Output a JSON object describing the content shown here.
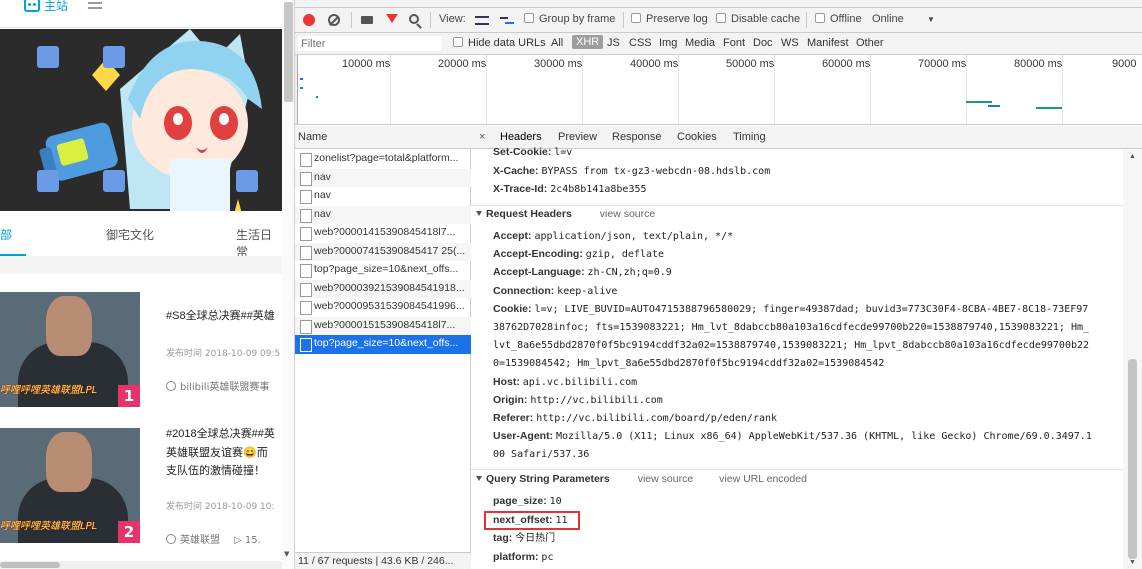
{
  "left_page": {
    "home_label": "主站",
    "tabs": [
      "部",
      "御宅文化",
      "生活日常"
    ],
    "cards": [
      {
        "title": "#S8全球总决赛##英雄",
        "date": "发布时间 2018-10-09 09:5",
        "uploader": "bilibili英雄联盟赛事",
        "thumb_caption": "呼哩呼哩英雄联盟LPL",
        "rank": "1"
      },
      {
        "title": "#2018全球总决赛##英",
        "title_line2": "英雄联盟友谊赛😄而",
        "title_line3": "支队伍的激情碰撞！",
        "date": "发布时间 2018-10-09 10:",
        "uploader": "英雄联盟",
        "views": "15.",
        "thumb_caption": "呼哩呼哩英雄联盟LPL",
        "rank": "2"
      }
    ],
    "colors": {
      "accent": "#00a1d6",
      "rank": "#e7336c"
    }
  },
  "devtools": {
    "toolbar": {
      "view_label": "View:",
      "group_by_frame": "Group by frame",
      "preserve_log": "Preserve log",
      "disable_cache": "Disable cache",
      "offline": "Offline",
      "throttle": "Online"
    },
    "filter_bar": {
      "placeholder": "Filter",
      "hide_data_urls": "Hide data URLs",
      "types": [
        "All",
        "XHR",
        "JS",
        "CSS",
        "Img",
        "Media",
        "Font",
        "Doc",
        "WS",
        "Manifest",
        "Other"
      ],
      "active_type": "XHR"
    },
    "timeline": {
      "ticks": [
        "10000 ms",
        "20000 ms",
        "30000 ms",
        "40000 ms",
        "50000 ms",
        "60000 ms",
        "70000 ms",
        "80000 ms",
        "9000"
      ]
    },
    "requests": {
      "header": "Name",
      "items": [
        "zonelist?page=total&platform...",
        "nav",
        "nav",
        "nav",
        "web?00001415390845418l7...",
        "web?00007415390845417 25(...",
        "top?page_size=10&next_offs...",
        "web?00003921539084541918...",
        "web?00009531539084541996...",
        "web?00001515390845418l7...",
        "top?page_size=10&next_offs..."
      ],
      "selected_index": 10,
      "status": "11 / 67 requests  |  43.6 KB / 246..."
    },
    "details": {
      "tabs": [
        "Headers",
        "Preview",
        "Response",
        "Cookies",
        "Timing"
      ],
      "close": "×",
      "response_headers": [
        {
          "key": "Set-Cookie:",
          "value": "l=v"
        },
        {
          "key": "X-Cache:",
          "value": "BYPASS from tx-gz3-webcdn-08.hdslb.com"
        },
        {
          "key": "X-Trace-Id:",
          "value": "2c4b8b141a8be355"
        }
      ],
      "request_headers_title": "Request Headers",
      "view_source": "view source",
      "request_headers": [
        {
          "key": "Accept:",
          "value": "application/json, text/plain, */*"
        },
        {
          "key": "Accept-Encoding:",
          "value": "gzip, deflate"
        },
        {
          "key": "Accept-Language:",
          "value": "zh-CN,zh;q=0.9"
        },
        {
          "key": "Connection:",
          "value": "keep-alive"
        },
        {
          "key": "Cookie:",
          "value": "l=v; LIVE_BUVID=AUTO4715388796580029; finger=49387dad; buvid3=773C30F4-8CBA-4BE7-8C18-73EF97"
        },
        {
          "key": "",
          "value": "38762D7028infoc; fts=1539083221; Hm_lvt_8dabccb80a103a16cdfecde99700b220=1538879740,1539083221; Hm_"
        },
        {
          "key": "",
          "value": "lvt_8a6e55dbd2870f0f5bc9194cddf32a02=1538879740,1539083221; Hm_lpvt_8dabccb80a103a16cdfecde99700b22"
        },
        {
          "key": "",
          "value": "0=1539084542; Hm_lpvt_8a6e55dbd2870f0f5bc9194cddf32a02=1539084542"
        },
        {
          "key": "Host:",
          "value": "api.vc.bilibili.com"
        },
        {
          "key": "Origin:",
          "value": "http://vc.bilibili.com"
        },
        {
          "key": "Referer:",
          "value": "http://vc.bilibili.com/board/p/eden/rank"
        },
        {
          "key": "User-Agent:",
          "value": "Mozilla/5.0 (X11; Linux x86_64) AppleWebKit/537.36 (KHTML, like Gecko) Chrome/69.0.3497.1"
        },
        {
          "key": "",
          "value": "00 Safari/537.36"
        }
      ],
      "query_title": "Query String Parameters",
      "view_url_encoded": "view URL encoded",
      "query_params": [
        {
          "key": "page_size:",
          "value": "10"
        },
        {
          "key": "next_offset:",
          "value": "11"
        },
        {
          "key": "tag:",
          "value": "今日热门"
        },
        {
          "key": "platform:",
          "value": "pc"
        }
      ],
      "highlight_color": "#e33333"
    }
  }
}
